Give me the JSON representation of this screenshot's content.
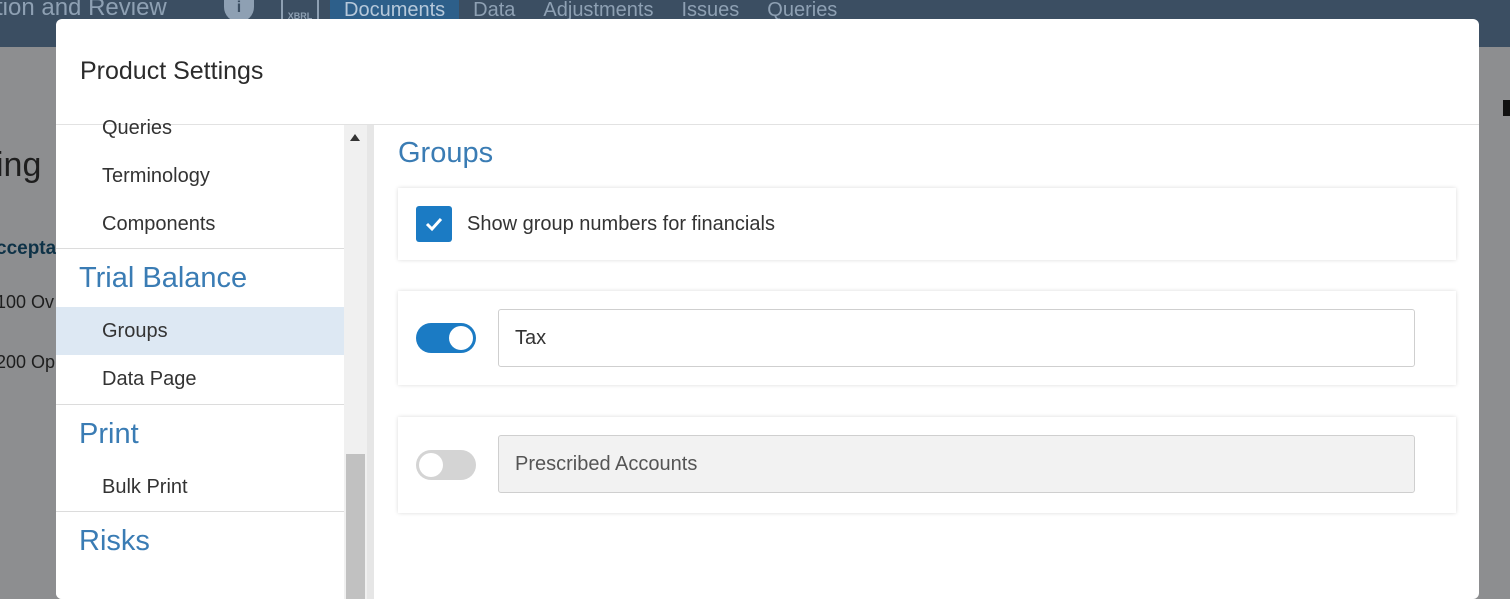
{
  "background": {
    "title_fragment": "tion and Review",
    "xbrl_label": "XBRL",
    "tabs": [
      "Documents",
      "Data",
      "Adjustments",
      "Issues",
      "Queries"
    ],
    "active_tab_index": 0,
    "heading_fragment": "ing",
    "accept_fragment": "ccepta",
    "row1_fragment": "100 Ov",
    "row2_fragment": "200 Op"
  },
  "modal": {
    "title": "Product Settings"
  },
  "sidebar": {
    "items": [
      {
        "label": "Queries"
      },
      {
        "label": "Terminology"
      },
      {
        "label": "Components"
      },
      {
        "section": "Trial Balance"
      },
      {
        "label": "Groups",
        "selected": true
      },
      {
        "label": "Data Page"
      },
      {
        "section": "Print"
      },
      {
        "label": "Bulk Print"
      },
      {
        "section": "Risks"
      }
    ]
  },
  "content": {
    "title": "Groups",
    "show_group_numbers": {
      "label": "Show group numbers for financials",
      "checked": true
    },
    "groups": [
      {
        "name": "Tax",
        "enabled": true
      },
      {
        "name": "Prescribed Accounts",
        "enabled": false
      }
    ]
  },
  "colors": {
    "accent": "#1b7bc4",
    "section_heading": "#3a7cb4",
    "selected_row": "#dde8f3"
  }
}
